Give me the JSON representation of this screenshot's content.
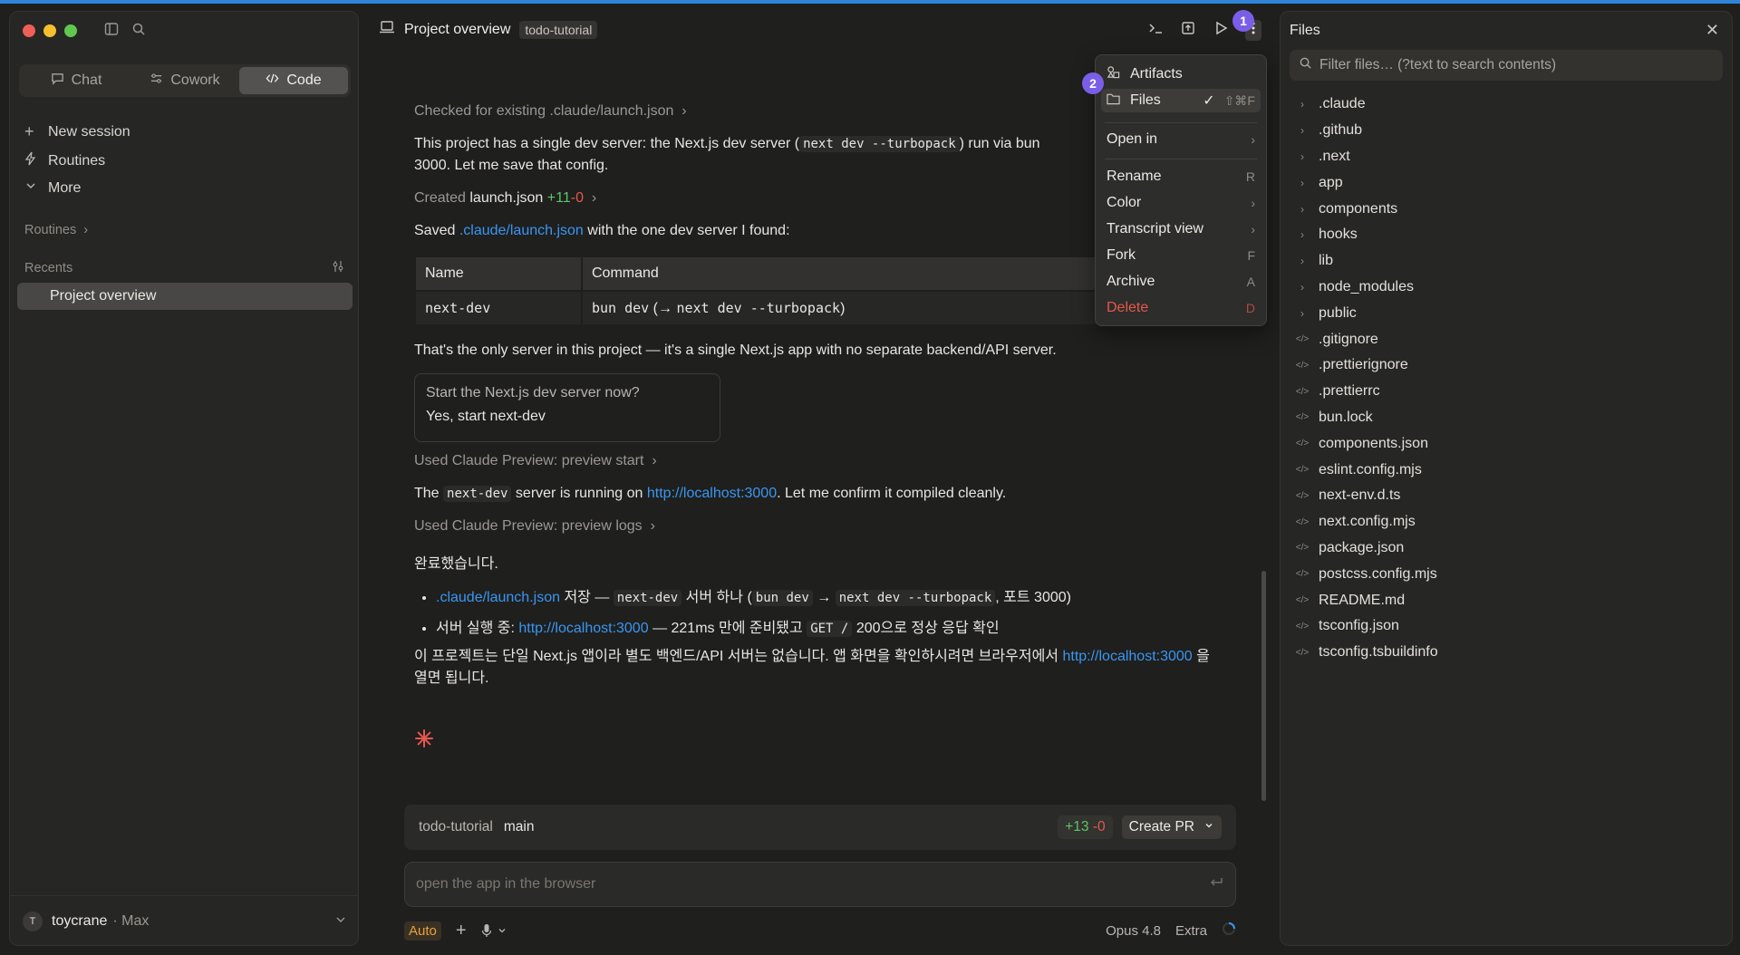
{
  "sidebar": {
    "tabs": [
      {
        "label": "Chat",
        "icon": "chat-bubble-icon",
        "active": false
      },
      {
        "label": "Cowork",
        "icon": "cowork-icon",
        "active": false
      },
      {
        "label": "Code",
        "icon": "code-icon",
        "active": true
      }
    ],
    "nav": {
      "new_session": "New session",
      "routines": "Routines",
      "more": "More"
    },
    "routines_label": "Routines",
    "recents_label": "Recents",
    "recents": [
      "Project overview"
    ],
    "user": {
      "initial": "T",
      "name": "toycrane",
      "plan": "· Max"
    }
  },
  "header": {
    "title": "Project overview",
    "tag": "todo-tutorial",
    "badge1": "1",
    "badge2": "2"
  },
  "chat": {
    "checked": "Checked for existing .claude/launch.json",
    "p1a": "This project has a single dev server: the Next.js dev server (",
    "p1_code": "next dev --turbopack",
    "p1b": ") run via bun",
    "p1c": "3000. Let me save that config.",
    "created_prefix": "Created",
    "created_file": "launch.json",
    "created_add": "+11",
    "created_del": "-0",
    "saved_prefix": "Saved",
    "saved_link": ".claude/launch.json",
    "saved_suffix": "with the one dev server I found:",
    "table": {
      "headers": [
        "Name",
        "Command"
      ],
      "row": {
        "name": "next-dev",
        "cmd_a": "bun dev",
        "cmd_arrow": " (→ ",
        "cmd_b": "next dev --turbopack",
        "cmd_end": ")"
      }
    },
    "only_server": "That's the only server in this project — it's a single Next.js app with no separate backend/API server.",
    "question": "Start the Next.js dev server now?",
    "answer": "Yes, start next-dev",
    "used_start": "Used Claude Preview: preview start",
    "running_a": "The",
    "running_code": "next-dev",
    "running_b": "server is running on",
    "running_link": "http://localhost:3000",
    "running_c": ". Let me confirm it compiled cleanly.",
    "used_logs": "Used Claude Preview: preview logs",
    "done": "완료했습니다.",
    "b1_link": ".claude/launch.json",
    "b1_a": "저장 —",
    "b1_code1": "next-dev",
    "b1_b": "서버 하나 (",
    "b1_code2": "bun dev",
    "b1_arrow": "→",
    "b1_code3": "next dev --turbopack",
    "b1_c": ", 포트 3000)",
    "b2_a": "서버 실행 중:",
    "b2_link": "http://localhost:3000",
    "b2_b": "— 221ms 만에 준비됐고",
    "b2_code": "GET /",
    "b2_c": "200으로 정상 응답 확인",
    "p_final_a": "이 프로젝트는 단일 Next.js 앱이라 별도 백엔드/API 서버는 없습니다. 앱 화면을 확인하시려면 브라우저에서",
    "p_final_link": "http://localhost:3000",
    "p_final_b": "을",
    "p_final_c": "열면 됩니다."
  },
  "status": {
    "repo": "todo-tutorial",
    "branch": "main",
    "add": "+13",
    "del": "-0",
    "create_pr": "Create PR"
  },
  "input": {
    "placeholder": "open the app in the browser"
  },
  "bottom": {
    "mode": "Auto",
    "model": "Opus 4.8",
    "effort": "Extra"
  },
  "menu": {
    "items": [
      {
        "label": "Artifacts",
        "shortcut": ""
      },
      {
        "label": "Files",
        "check": "✓",
        "shortcut": "⇧⌘F"
      },
      {
        "label": "Open in",
        "shortcut": "›"
      },
      {
        "label": "Rename",
        "shortcut": "R"
      },
      {
        "label": "Color",
        "shortcut": "›"
      },
      {
        "label": "Transcript view",
        "shortcut": "›"
      },
      {
        "label": "Fork",
        "shortcut": "F"
      },
      {
        "label": "Archive",
        "shortcut": "A"
      },
      {
        "label": "Delete",
        "shortcut": "D"
      }
    ]
  },
  "files": {
    "title": "Files",
    "filter_placeholder": "Filter files… (?text to search contents)",
    "folders": [
      ".claude",
      ".github",
      ".next",
      "app",
      "components",
      "hooks",
      "lib",
      "node_modules",
      "public"
    ],
    "items": [
      ".gitignore",
      ".prettierignore",
      ".prettierrc",
      "bun.lock",
      "components.json",
      "eslint.config.mjs",
      "next-env.d.ts",
      "next.config.mjs",
      "package.json",
      "postcss.config.mjs",
      "README.md",
      "tsconfig.json",
      "tsconfig.tsbuildinfo"
    ]
  },
  "colors": {
    "accent_blue": "#3a96f0",
    "badge_purple": "#7b5ee8",
    "diff_green": "#5cc46a",
    "diff_red": "#e4584d",
    "spark": "#e4584d"
  }
}
